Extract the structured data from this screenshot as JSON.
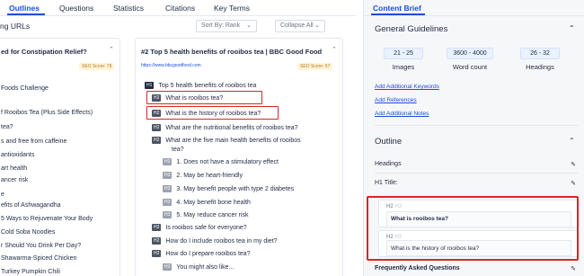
{
  "tabs": [
    "Outlines",
    "Questions",
    "Statistics",
    "Citations",
    "Key Terms"
  ],
  "subtitle": "ng URLs",
  "sort": {
    "label": "Sort By: Rank",
    "chevron": "⌄"
  },
  "collapse": {
    "label": "Collapse All",
    "chevron": "⌄"
  },
  "left_card": {
    "title": "ed for Constipation Relief?",
    "seo": "SEO Score: 78",
    "items": [
      "Foods Challenge",
      "f Rooibos Tea (Plus Side Effects)",
      "tea?",
      "s and free from caffeine",
      "antioxidants",
      "art health",
      "ancer risk",
      "e",
      "efits of Ashwagandha",
      "5 Ways to Rejuvenate Your Body",
      "Cold Soba Noodles",
      "r Should You Drink Per Day?",
      "Shawarma-Spiced Chicken",
      "Turkey Pumpkin Chili"
    ]
  },
  "mid_card": {
    "title": "#2  Top 5 health benefits of rooibos tea | BBC Good Food",
    "url": "https://www.bbcgoodfood.com",
    "seo": "SEO Score: 67",
    "headings": [
      {
        "tag": "H1",
        "text": "Top 5 health benefits of rooibos tea"
      },
      {
        "tag": "H2",
        "text": "What is rooibos tea?"
      },
      {
        "tag": "H2",
        "text": "What is the history of rooibos tea?"
      },
      {
        "tag": "H2",
        "text": "What are the nutritional benefits of rooibos tea?"
      },
      {
        "tag": "H2",
        "text": "What are the five main health benefits of rooibos",
        "text2": "tea?"
      },
      {
        "tag": "H3",
        "text": "1. Does not have a stimulatory effect"
      },
      {
        "tag": "H3",
        "text": "2. May be heart-friendly"
      },
      {
        "tag": "H3",
        "text": "3. May benefit people with type 2 diabetes"
      },
      {
        "tag": "H3",
        "text": "4. May benefit bone health"
      },
      {
        "tag": "H3",
        "text": "5. May reduce cancer risk"
      },
      {
        "tag": "H2",
        "text": "Is rooibos safe for everyone?"
      },
      {
        "tag": "H2",
        "text": "How do I include rooibos tea in my diet?"
      },
      {
        "tag": "H2",
        "text": "How do I prepare rooibos tea?"
      },
      {
        "tag": "H3",
        "text": "You might also like..."
      }
    ]
  },
  "brief": {
    "tab": "Content Brief",
    "general_guidelines": "General Guidelines",
    "stats": [
      {
        "value": "21 - 25",
        "label": "Images"
      },
      {
        "value": "3600 - 4000",
        "label": "Word count"
      },
      {
        "value": "26 - 32",
        "label": "Headings"
      }
    ],
    "links": [
      "Add Additional Keywords",
      "Add References",
      "Add Additional Notes"
    ],
    "outline": "Outline",
    "headings_row": "Headings",
    "h1_row": "H1 Title:",
    "cards": [
      {
        "tag_active": "H2",
        "tag_dim": "H3",
        "value": "What is rooibos tea?"
      },
      {
        "tag_active": "H2",
        "tag_dim": "H3",
        "value": "What is the history of rooibos tea?"
      }
    ],
    "faq": "Frequently Asked Questions"
  },
  "icons": {
    "chevron_up": "⌃",
    "chevron_down": "⌄",
    "pencil": "✎"
  },
  "colors": {
    "accent": "#1d4ed8",
    "highlight": "#dc2626",
    "seo_bg": "#fff4d6"
  }
}
